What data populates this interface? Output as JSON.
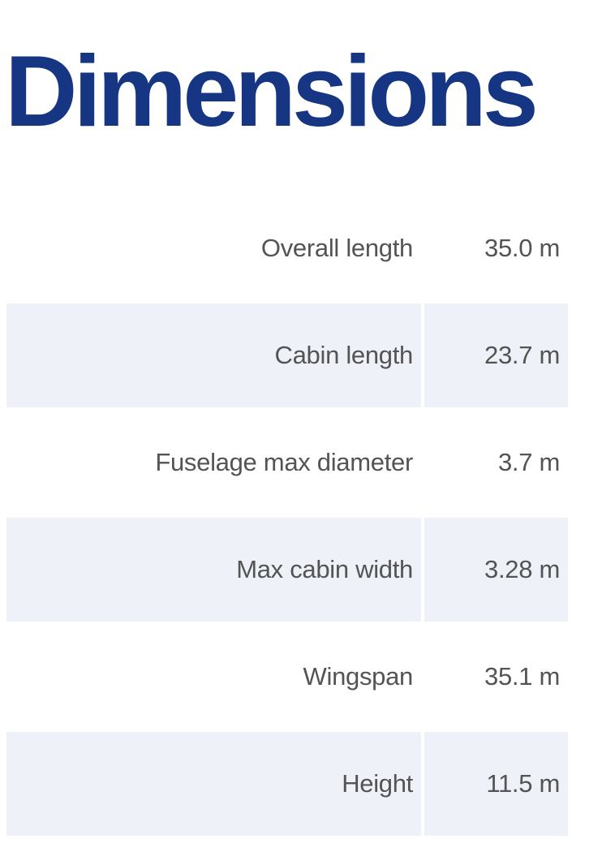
{
  "page": {
    "title": "Dimensions",
    "title_color": "#163683",
    "row_shade_color": "#eef1f8",
    "text_color": "#545454"
  },
  "specs": [
    {
      "label": "Overall length",
      "value": "35.0 m"
    },
    {
      "label": "Cabin length",
      "value": "23.7 m"
    },
    {
      "label": "Fuselage max diameter",
      "value": "3.7 m"
    },
    {
      "label": "Max cabin width",
      "value": "3.28 m"
    },
    {
      "label": "Wingspan",
      "value": "35.1 m"
    },
    {
      "label": "Height",
      "value": "11.5 m"
    }
  ]
}
